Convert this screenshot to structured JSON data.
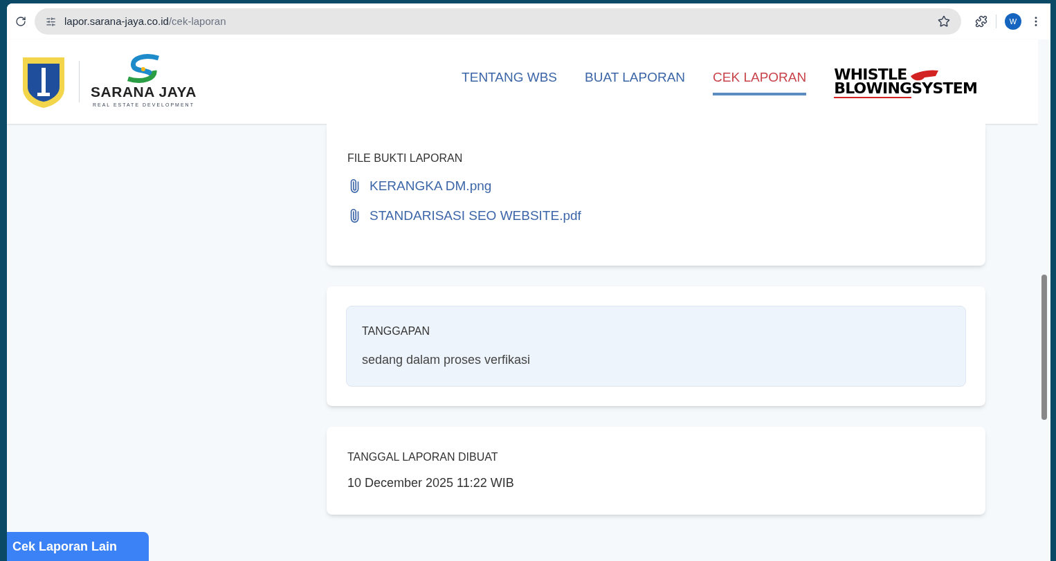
{
  "browser": {
    "url_host": "lapor.sarana-jaya.co.id",
    "url_path": "/cek-laporan",
    "profile_initial": "W"
  },
  "header": {
    "brand_name": "SARANA JAYA",
    "brand_tagline": "REAL ESTATE DEVELOPMENT",
    "nav": [
      {
        "label": "TENTANG WBS",
        "selected": false
      },
      {
        "label": "BUAT LAPORAN",
        "selected": false
      },
      {
        "label": "CEK LAPORAN",
        "selected": true
      }
    ],
    "wbs_logo": [
      "WHISTLE",
      "BLOWING",
      "SYSTEM"
    ]
  },
  "files": {
    "label": "FILE BUKTI LAPORAN",
    "items": [
      "KERANGKA DM.png",
      "STANDARISASI SEO WEBSITE.pdf"
    ]
  },
  "response": {
    "label": "TANGGAPAN",
    "text": "sedang dalam proses verfikasi"
  },
  "created": {
    "label": "TANGGAL LAPORAN DIBUAT",
    "value": "10 December 2025 11:22 WIB"
  },
  "floating_button": "Cek Laporan Lain"
}
